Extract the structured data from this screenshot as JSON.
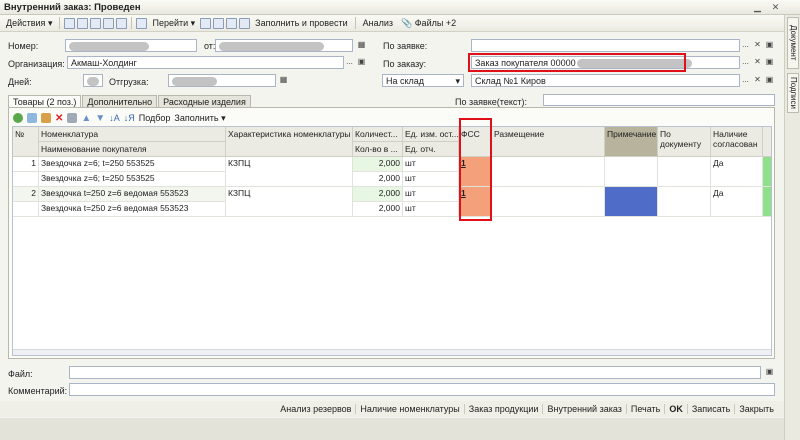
{
  "window": {
    "title": "Внутренний заказ: Проведен"
  },
  "toolbar": {
    "actions": "Действия",
    "goto": "Перейти",
    "fill_post": "Заполнить и провести",
    "analysis": "Анализ",
    "files": "Файлы +2"
  },
  "side_tabs": [
    "Документ",
    "Подписи"
  ],
  "form": {
    "number_label": "Номер:",
    "from_label": "от:",
    "org_label": "Организация:",
    "org_value": "Акмаш-Холдинг",
    "days_label": "Дней:",
    "shipment_label": "Отгрузка:",
    "by_request_label": "По заявке:",
    "by_order_label": "По заказу:",
    "by_order_value": "Заказ покупателя 00000",
    "warehouse_label": "На склад",
    "warehouse_value": "Склад №1 Киров",
    "by_request_text_label": "По заявке(текст):"
  },
  "tabs": [
    "Товары (2 поз.)",
    "Дополнительно",
    "Расходные изделия"
  ],
  "subtoolbar": {
    "pick": "Подбор",
    "fill": "Заполнить"
  },
  "table": {
    "headers": {
      "n": "№",
      "item": "Номенклатура",
      "buyer_name": "Наименование покупателя",
      "char": "Характеристика номенклатуры",
      "qty": "Количест...",
      "qty_places": "Кол-во в ...",
      "unit_store": "Ед. изм. ост...",
      "unit_rep": "Ед. отч.",
      "fss": "ФСС",
      "placement": "Размещение",
      "note": "Примечание",
      "by_doc_1": "По",
      "by_doc_2": "документу",
      "agreed_1": "Наличие",
      "agreed_2": "согласован"
    },
    "rows": [
      {
        "n": "1",
        "item": "Звездочка z=6; t=250 553525",
        "buyer": "Звездочка z=6; t=250 553525",
        "char": "КЗПЦ",
        "qty": "2,000",
        "qty2": "2,000",
        "unit": "шт",
        "unit2": "шт",
        "fss": "1",
        "agreed": "Да"
      },
      {
        "n": "2",
        "item": "Звездочка t=250 z=6 ведомая 553523",
        "buyer": "Звездочка t=250 z=6 ведомая 553523",
        "char": "КЗПЦ",
        "qty": "2,000",
        "qty2": "2,000",
        "unit": "шт",
        "unit2": "шт",
        "fss": "1",
        "agreed": "Да"
      }
    ]
  },
  "bottom": {
    "file_label": "Файл:",
    "comment_label": "Комментарий:"
  },
  "footer": [
    "Анализ резервов",
    "Наличие номенклатуры",
    "Заказ продукции",
    "Внутренний заказ",
    "Печать",
    "OK",
    "Записать",
    "Закрыть"
  ],
  "colors": {
    "fss": "#f4a07a",
    "highlight": "#e0101a",
    "note_blue": "#4e6cc8",
    "note_header": "#b7b39d"
  }
}
